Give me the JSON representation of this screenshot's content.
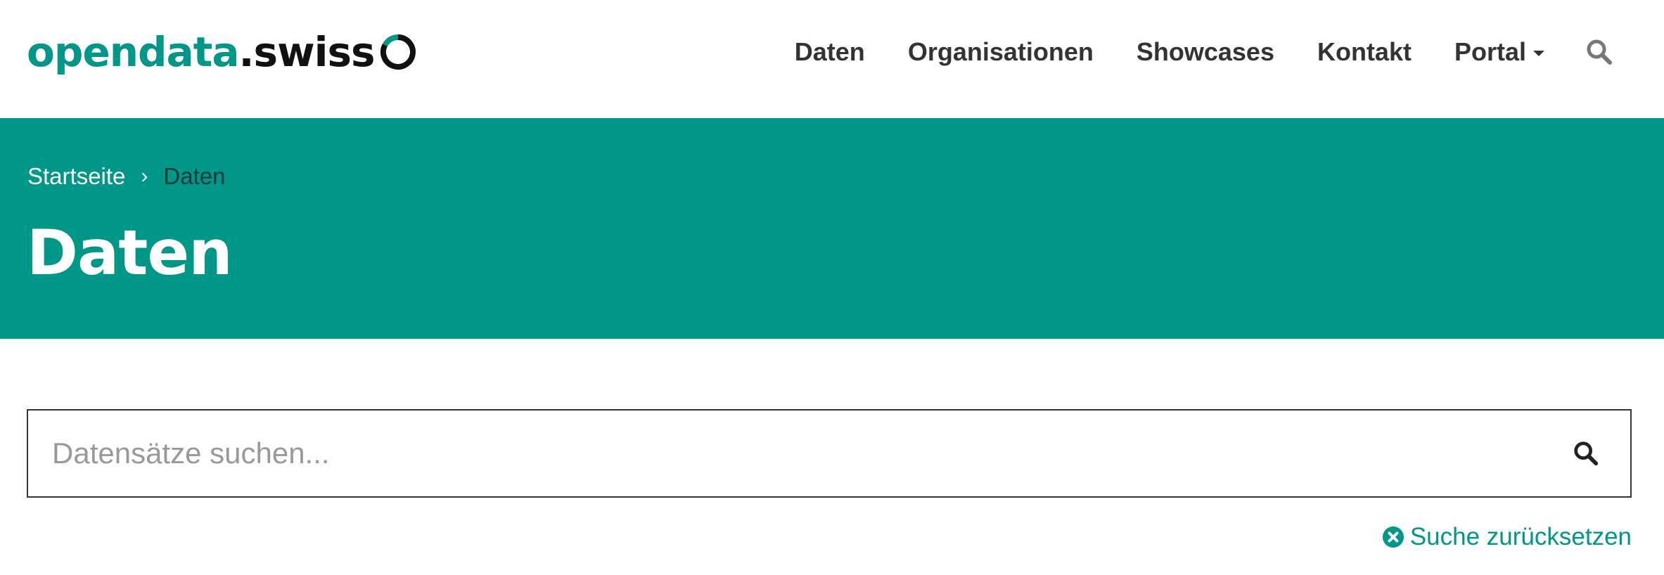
{
  "logo": {
    "part1": "opendata",
    "part2": ".swiss",
    "brand_color": "#009688"
  },
  "nav": {
    "items": [
      "Daten",
      "Organisationen",
      "Showcases",
      "Kontakt"
    ],
    "portal_label": "Portal",
    "search_icon": "search-icon"
  },
  "breadcrumb": {
    "home": "Startseite",
    "separator": "›",
    "current": "Daten"
  },
  "page": {
    "title": "Daten"
  },
  "search": {
    "placeholder": "Datensätze suchen...",
    "value": "",
    "button_icon": "search-icon"
  },
  "reset": {
    "label": "Suche zurücksetzen",
    "icon": "times-circle-icon"
  },
  "colors": {
    "accent": "#009688",
    "text": "#333333",
    "hero_bg": "#009688"
  }
}
